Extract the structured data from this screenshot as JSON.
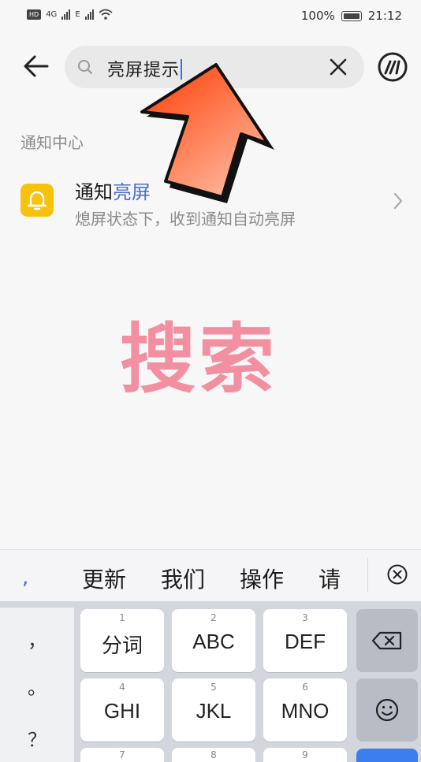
{
  "status_bar": {
    "left_badges": [
      "HD",
      "4G",
      "E"
    ],
    "battery": "100%",
    "time": "21:12"
  },
  "header": {
    "back_icon": "back-arrow-icon",
    "search_query": "亮屏提示",
    "search_icon": "search-icon",
    "clear_icon": "close-icon",
    "brand_icon": "brand-logo-icon"
  },
  "results": {
    "section_title": "通知中心",
    "items": [
      {
        "icon": "bell-icon",
        "title_prefix": "通知",
        "title_highlight": "亮屏",
        "subtitle": "熄屏状态下，收到通知自动亮屏"
      }
    ]
  },
  "overlay": {
    "caption": "搜索",
    "caption_color": "#f28fa0",
    "arrow_color": "#ff4a10"
  },
  "keyboard": {
    "candidate_comma": ",",
    "candidates": [
      "更新",
      "我们",
      "操作",
      "请"
    ],
    "candidate_close_icon": "circle-x-icon",
    "punctuation": [
      "，",
      "。",
      "？"
    ],
    "keys": [
      {
        "num": "1",
        "label": "分词"
      },
      {
        "num": "2",
        "label": "ABC"
      },
      {
        "num": "3",
        "label": "DEF"
      },
      {
        "num": "4",
        "label": "GHI"
      },
      {
        "num": "5",
        "label": "JKL"
      },
      {
        "num": "6",
        "label": "MNO"
      }
    ],
    "next_row_nums": [
      "7",
      "8",
      "9"
    ],
    "backspace_icon": "backspace-icon",
    "emoji_icon": "emoji-icon"
  }
}
